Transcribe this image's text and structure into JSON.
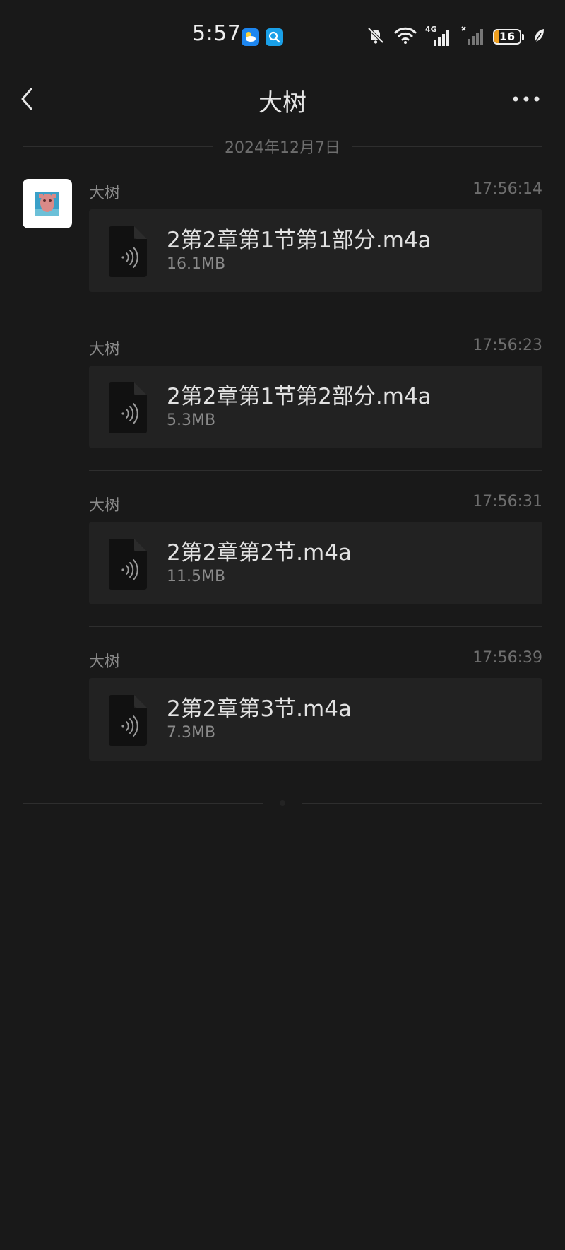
{
  "status_bar": {
    "time": "5:57",
    "network": "4G",
    "battery_level": "16",
    "battery_percent": 16
  },
  "header": {
    "title": "大树"
  },
  "chat": {
    "date": "2024年12月7日",
    "messages": [
      {
        "sender": "大树",
        "time": "17:56:14",
        "file_name": "2第2章第1节第1部分.m4a",
        "file_size": "16.1MB"
      },
      {
        "sender": "大树",
        "time": "17:56:23",
        "file_name": "2第2章第1节第2部分.m4a",
        "file_size": "5.3MB"
      },
      {
        "sender": "大树",
        "time": "17:56:31",
        "file_name": "2第2章第2节.m4a",
        "file_size": "11.5MB"
      },
      {
        "sender": "大树",
        "time": "17:56:39",
        "file_name": "2第2章第3节.m4a",
        "file_size": "7.3MB"
      }
    ]
  },
  "colors": {
    "background": "#191919",
    "card": "#222222",
    "battery_accent": "#f0a020"
  }
}
